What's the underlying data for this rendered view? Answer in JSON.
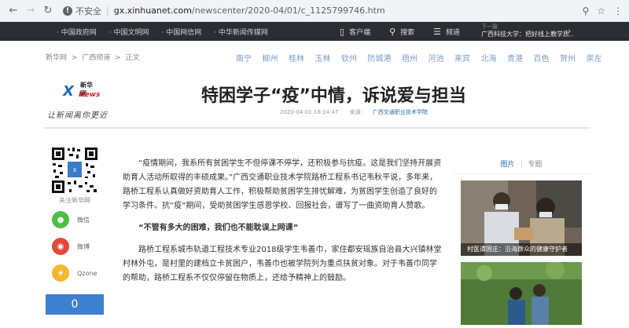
{
  "browser": {
    "insecure_label": "不安全",
    "url_host": "gx.xinhuanet.com",
    "url_path": "/newscenter/2020-04/01/c_1125799746.htm"
  },
  "topnav": {
    "sites": [
      "· 中国政府网",
      "· 中国文明网",
      "· 中国网信网",
      "· 中华新闻传媒网"
    ],
    "tools": [
      {
        "icon": "mobile-icon",
        "label": "客户端"
      },
      {
        "icon": "search-icon",
        "label": "搜索"
      },
      {
        "icon": "menu-icon",
        "label": "频道"
      }
    ],
    "next_label": "下一篇",
    "next_title": "广西科技大学：把好线上教学质..."
  },
  "breadcrumb": [
    "新华网",
    ">",
    "广西频道",
    ">",
    "正文"
  ],
  "cities": [
    "南宁",
    "柳州",
    "桂林",
    "玉林",
    "钦州",
    "防城港",
    "梧州",
    "河池",
    "来宾",
    "北海",
    "贵港",
    "百色",
    "贺州",
    "崇左"
  ],
  "logo": {
    "cn": "新华网",
    "en": "News",
    "slogan": "让新闻离你更近"
  },
  "article": {
    "title": "特困学子“疫”中情，诉说爱与担当",
    "date": "2020-04-01 18:14:47",
    "source_label": "来源：",
    "source": "广西交通职业技术学院",
    "paragraphs": [
      "“疫情期间，我系所有贫困学生不但停课不停学，还积极参与抗疫。这是我们坚持开展资助育人活动所取得的丰硕成果。”广西交通职业技术学院路桥工程系书记韦秋平说，多年来，路桥工程系认真做好资助育人工作，积极帮助贫困学生排忧解难，为贫困学生创造了良好的学习条件。抗“疫”期间，受助贫困学生感恩学校、回报社会，谱写了一曲资助育人赞歌。",
      "路桥工程系城市轨道工程技术专业2018级学生韦善巾，家住都安瑶族自治县大兴镇林堂村林外屯，是村里的建档立卡贫困户，韦善巾也被学院列为重点扶贫对象。对于韦善巾同学的帮助，路桥工程系不仅仅停留在物质上，还给予精神上的鼓励。"
    ],
    "subheading": "“不管有多大的困难，我们也不能耽误上网课”"
  },
  "share": {
    "follow_label": "关注新华网",
    "items": [
      {
        "icon": "wechat-icon",
        "label": "微信",
        "color": "#4fbe45"
      },
      {
        "icon": "weibo-icon",
        "label": "微博",
        "color": "#e04a3b"
      },
      {
        "icon": "qzone-icon",
        "label": "Qzone",
        "color": "#f5b82e"
      }
    ],
    "like_count": "0"
  },
  "sidebar": {
    "tabs": [
      "图片",
      "专题"
    ],
    "pictures": [
      {
        "caption": "村医谭国庄：沿海群众的健康守护者"
      },
      {
        "caption": ""
      }
    ]
  }
}
